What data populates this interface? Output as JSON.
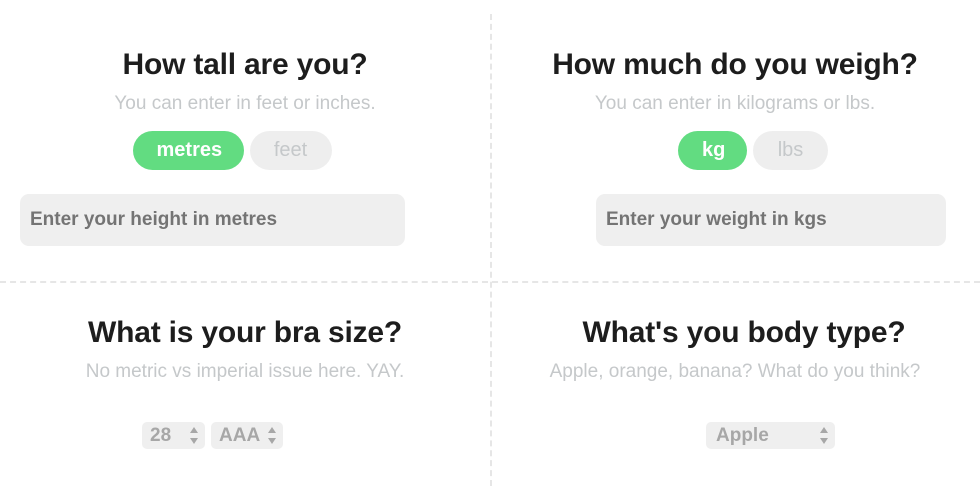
{
  "height": {
    "title": "How tall are you?",
    "subtitle": "You can enter in feet or inches.",
    "units": [
      {
        "label": "metres",
        "selected": true
      },
      {
        "label": "feet",
        "selected": false
      }
    ],
    "input": {
      "placeholder": "Enter your height in metres",
      "value": ""
    }
  },
  "weight": {
    "title": "How much do you weigh?",
    "subtitle": "You can enter in kilograms or lbs.",
    "units": [
      {
        "label": "kg",
        "selected": true
      },
      {
        "label": "lbs",
        "selected": false
      }
    ],
    "input": {
      "placeholder": "Enter your weight in kgs",
      "value": ""
    }
  },
  "bra": {
    "title": "What is your bra size?",
    "subtitle": "No metric vs imperial issue here. YAY.",
    "band_select": {
      "value": "28",
      "icon": "up-down-arrows-icon"
    },
    "cup_select": {
      "value": "AAA",
      "icon": "up-down-arrows-icon"
    }
  },
  "body_type": {
    "title": "What's you body type?",
    "subtitle": "Apple, orange, banana? What do you think?",
    "select": {
      "value": "Apple",
      "icon": "up-down-arrows-icon"
    }
  },
  "colors": {
    "accent": "#62dc81",
    "title": "#1d1d1d",
    "subtitle": "#c5c8ca",
    "input_bg": "#efefef",
    "divider": "#e6e6e6"
  }
}
